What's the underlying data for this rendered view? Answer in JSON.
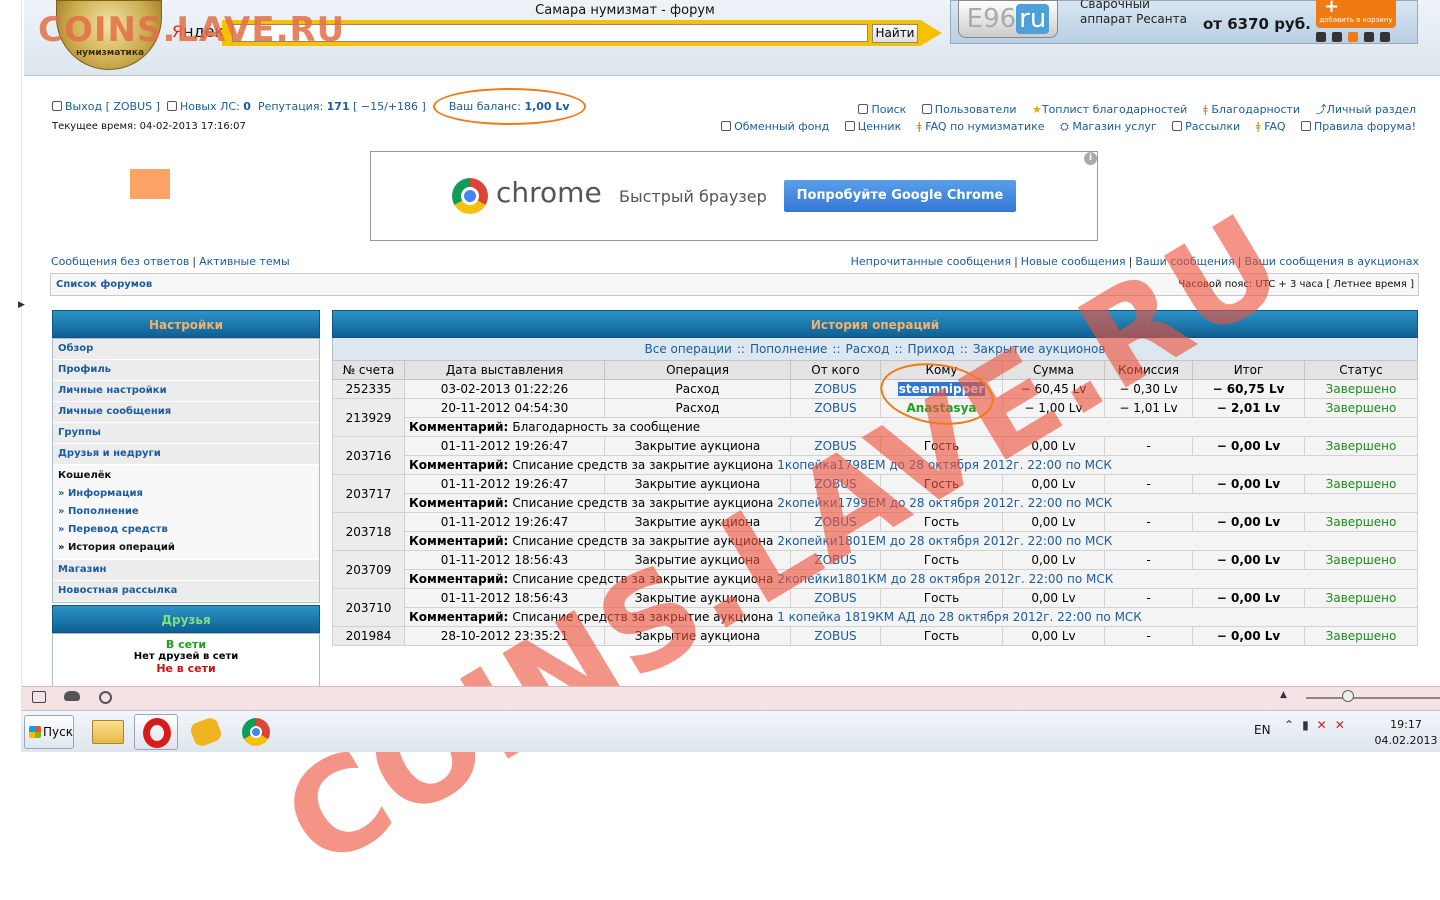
{
  "header": {
    "watermark_top": "COINS.LAVE.RU",
    "yandex_prefix": "Я",
    "yandex_rest": "ндекс",
    "site_title": "Самара нумизмат - форум",
    "search_button": "Найти",
    "logo_text": "нумизматика",
    "ad": {
      "brand_e": "E96",
      "brand_ru": "ru",
      "line1": "Сварочный",
      "line2": "аппарат Ресанта",
      "price": "от 6370 руб.",
      "cart_plus": "+",
      "cart_label": "добавить в корзину"
    }
  },
  "userbar": {
    "logout": "Выход [ ZOBUS ]",
    "new_pm_label": "Новых ЛС:",
    "new_pm_count": "0",
    "rep_label": "Репутация:",
    "rep_value": "171",
    "rep_detail": "[ −15/+186 ]",
    "balance_label": "Ваш баланс:",
    "balance_value": "1,00 Lv",
    "current_time": "Текущее время: 04-02-2013 17:16:07"
  },
  "toplinks1": [
    "Поиск",
    "Пользователи",
    "Топлист благодарностей",
    "Благодарности",
    "Личный раздел"
  ],
  "toplinks2": [
    "Обменный фонд",
    "Ценник",
    "FAQ по нумизматике",
    "Магазин услуг",
    "Рассылки",
    "FAQ",
    "Правила форума!"
  ],
  "chrome_ad": {
    "word": "chrome",
    "slogan": "Быстрый браузер",
    "button": "Попробуйте Google Chrome",
    "info": "i"
  },
  "nav": {
    "left": [
      "Сообщения без ответов",
      "Активные темы"
    ],
    "right": [
      "Непрочитанные сообщения",
      "Новые сообщения",
      "Ваши сообщения",
      "Ваши сообщения в аукционах"
    ],
    "sep": "|",
    "crumb": "Список форумов",
    "timezone": "Часовой пояс: UTC + 3 часа [ Летнее время ]"
  },
  "sidebar": {
    "title": "Настройки",
    "items": [
      "Обзор",
      "Профиль",
      "Личные настройки",
      "Личные сообщения",
      "Группы",
      "Друзья и недруги"
    ],
    "wallet_title": "Кошелёк",
    "wallet_items": [
      "» Информация",
      "» Пополнение",
      "» Перевод средств",
      "» История операций"
    ],
    "items_after": [
      "Магазин",
      "Новостная рассылка"
    ],
    "friends_title": "Друзья",
    "online": "В сети",
    "no_friends": "Нет друзей в сети",
    "offline": "Не в сети"
  },
  "ops": {
    "title": "История операций",
    "filters": [
      "Все операции",
      "Пополнение",
      "Расход",
      "Приход",
      "Закрытие аукционов"
    ],
    "filter_sep": "::",
    "columns": [
      "№ счета",
      "Дата выставления",
      "Операция",
      "От кого",
      "Кому",
      "Сумма",
      "Комиссия",
      "Итог",
      "Статус"
    ],
    "comment_label": "Комментарий:",
    "rows": [
      {
        "acct": "252335",
        "date": "03-02-2013 01:22:26",
        "op": "Расход",
        "from": "ZOBUS",
        "to": "steamnipper",
        "sum": "− 60,45 Lv",
        "fee": "− 0,30 Lv",
        "total": "− 60,75 Lv",
        "status": "Завершено",
        "comment": "",
        "link": ""
      },
      {
        "acct": "213929",
        "date": "20-11-2012 04:54:30",
        "op": "Расход",
        "from": "ZOBUS",
        "to": "Anastasya",
        "sum": "− 1,00 Lv",
        "fee": "− 1,01 Lv",
        "total": "− 2,01 Lv",
        "status": "Завершено",
        "comment": "Благодарность за сообщение",
        "link": ""
      },
      {
        "acct": "203716",
        "date": "01-11-2012 19:26:47",
        "op": "Закрытие аукциона",
        "from": "ZOBUS",
        "to": "Гость",
        "sum": "0,00 Lv",
        "fee": "-",
        "total": "− 0,00 Lv",
        "status": "Завершено",
        "comment": "Списание средств за закрытие аукциона",
        "link": "1копейка1798ЕМ до 28 октября 2012г. 22:00 по МСК"
      },
      {
        "acct": "203717",
        "date": "01-11-2012 19:26:47",
        "op": "Закрытие аукциона",
        "from": "ZOBUS",
        "to": "Гость",
        "sum": "0,00 Lv",
        "fee": "-",
        "total": "− 0,00 Lv",
        "status": "Завершено",
        "comment": "Списание средств за закрытие аукциона",
        "link": "2копейки1799ЕМ до 28 октября 2012г. 22:00 по МСК"
      },
      {
        "acct": "203718",
        "date": "01-11-2012 19:26:47",
        "op": "Закрытие аукциона",
        "from": "ZOBUS",
        "to": "Гость",
        "sum": "0,00 Lv",
        "fee": "-",
        "total": "− 0,00 Lv",
        "status": "Завершено",
        "comment": "Списание средств за закрытие аукциона",
        "link": "2копейки1801ЕМ до 28 октября 2012г. 22:00 по МСК"
      },
      {
        "acct": "203709",
        "date": "01-11-2012 18:56:43",
        "op": "Закрытие аукциона",
        "from": "ZOBUS",
        "to": "Гость",
        "sum": "0,00 Lv",
        "fee": "-",
        "total": "− 0,00 Lv",
        "status": "Завершено",
        "comment": "Списание средств за закрытие аукциона",
        "link": "2копейки1801КМ до 28 октября 2012г. 22:00 по МСК"
      },
      {
        "acct": "203710",
        "date": "01-11-2012 18:56:43",
        "op": "Закрытие аукциона",
        "from": "ZOBUS",
        "to": "Гость",
        "sum": "0,00 Lv",
        "fee": "-",
        "total": "− 0,00 Lv",
        "status": "Завершено",
        "comment": "Списание средств за закрытие аукциона",
        "link": "1 копейка 1819КМ АД до 28 октября 2012г. 22:00 по МСК"
      },
      {
        "acct": "201984",
        "date": "28-10-2012 23:35:21",
        "op": "Закрытие аукциона",
        "from": "ZOBUS",
        "to": "Гость",
        "sum": "0,00 Lv",
        "fee": "-",
        "total": "− 0,00 Lv",
        "status": "Завершено",
        "comment": "",
        "link": ""
      }
    ]
  },
  "watermark_big": "COINS.LAVE.RU",
  "taskbar": {
    "start": "Пуск",
    "lang": "EN",
    "time": "19:17",
    "date": "04.02.2013"
  },
  "colors": {
    "link": "#1b5c9e",
    "header_gradient_top": "#2c93c6",
    "header_text": "#f7b06b",
    "status_done": "#1e8a1e",
    "annotation_oval": "#f07a14",
    "watermark": "#ee523e"
  }
}
